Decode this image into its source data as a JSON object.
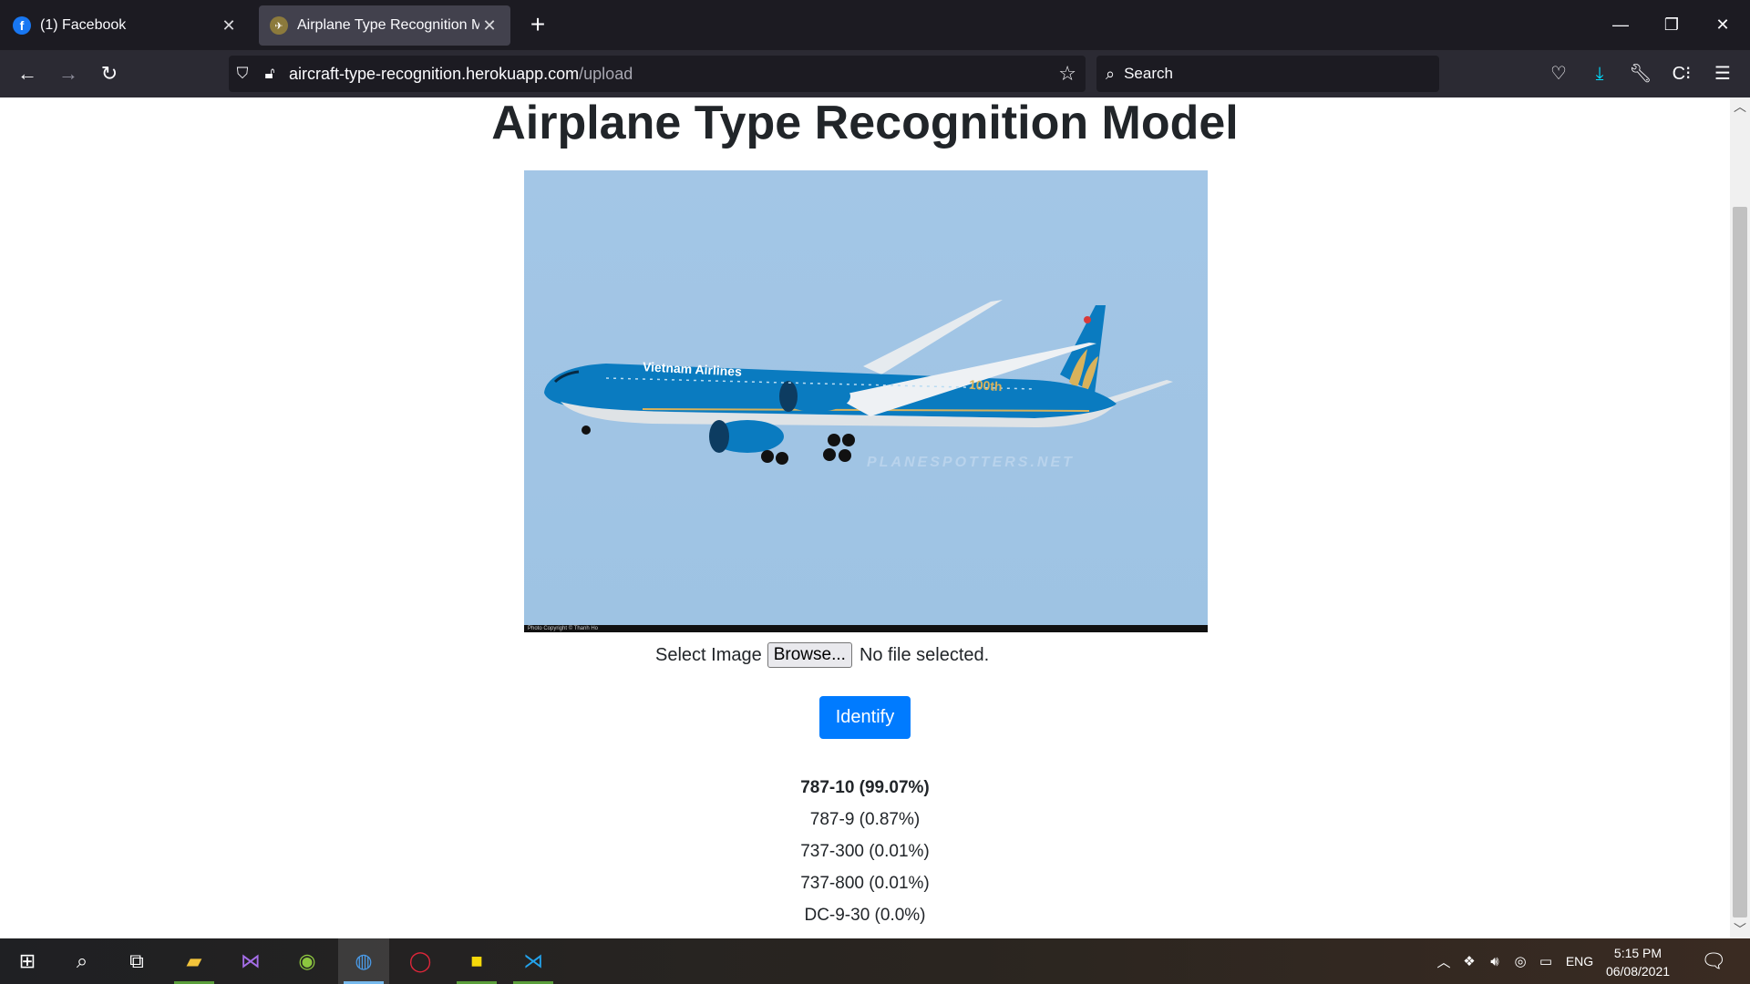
{
  "browser": {
    "tabs": [
      {
        "label": "(1) Facebook",
        "favicon": "facebook-icon",
        "active": false
      },
      {
        "label": "Airplane Type Recognition Mod",
        "favicon": "airplane-favicon",
        "active": true
      }
    ],
    "url_host": "aircraft-type-recognition.herokuapp.com",
    "url_path": "/upload",
    "search_placeholder": "Search"
  },
  "page": {
    "heading": "Airplane Type Recognition Model",
    "image_airline_text": "Vietnam Airlines",
    "image_tail_text": "100th",
    "image_watermark": "PLANESPOTTERS.NET",
    "image_credit": "Photo Copyright © Thanh Ho",
    "select_label": "Select Image",
    "browse_label": "Browse...",
    "file_status": "No file selected.",
    "identify_label": "Identify",
    "results": [
      "787-10 (99.07%)",
      "787-9 (0.87%)",
      "737-300 (0.01%)",
      "737-800 (0.01%)",
      "DC-9-30 (0.0%)"
    ]
  },
  "taskbar": {
    "time": "5:15 PM",
    "date": "06/08/2021",
    "lang": "ENG"
  },
  "colors": {
    "accent_button": "#007bff",
    "tabstrip": "#1c1b22",
    "navbar": "#2b2a33",
    "download_icon": "#00ddff",
    "airline_blue": "#0a7bc0",
    "airline_gold": "#d8b25b"
  }
}
